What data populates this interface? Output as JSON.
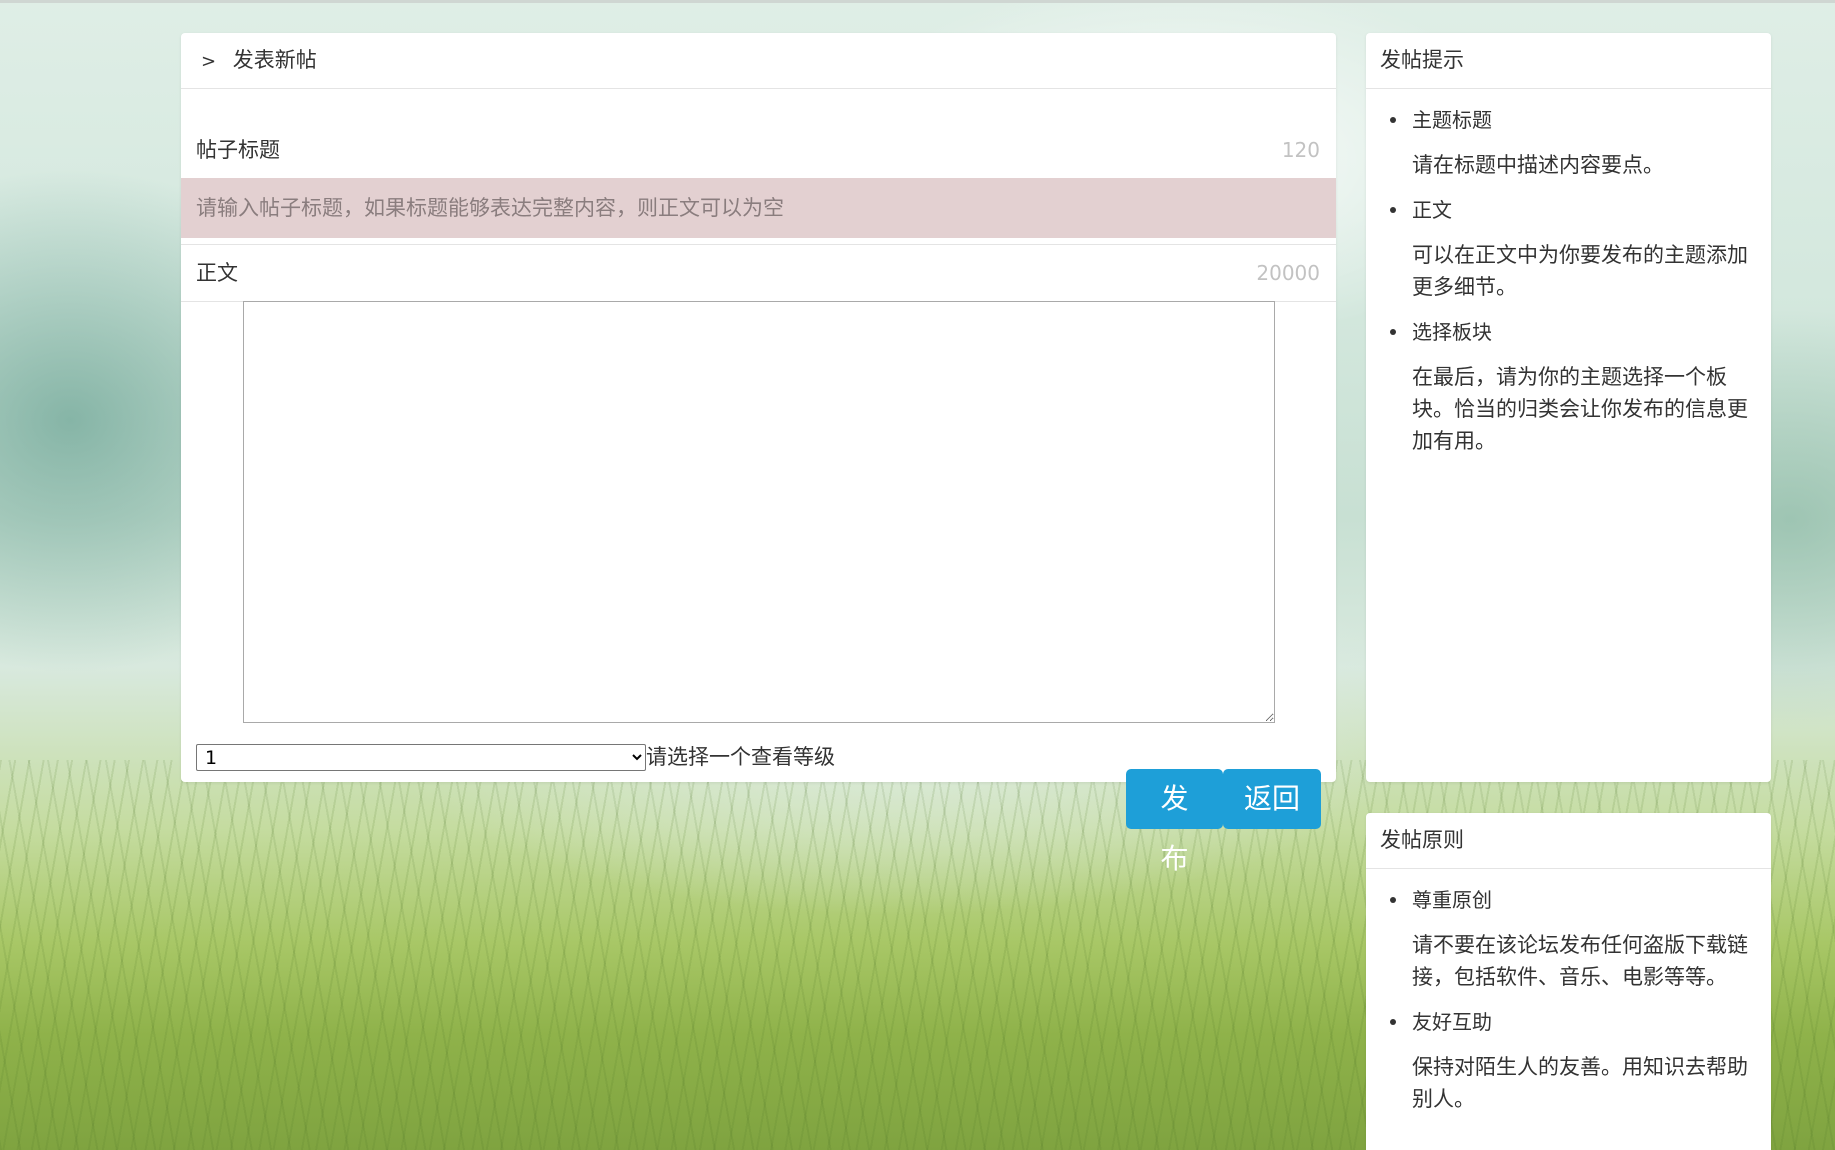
{
  "post_form": {
    "header_arrow": ">",
    "header_title": "发表新帖",
    "title_label": "帖子标题",
    "title_limit": "120",
    "title_placeholder": "请输入帖子标题，如果标题能够表达完整内容，则正文可以为空",
    "body_label": "正文",
    "body_limit": "20000",
    "body_value": "",
    "level_selected": "1",
    "level_hint": "请选择一个查看等级",
    "publish_label": "发布",
    "back_label": "返回"
  },
  "tips": {
    "title": "发帖提示",
    "items": [
      {
        "title": "主题标题",
        "text": "请在标题中描述内容要点。"
      },
      {
        "title": "正文",
        "text": "可以在正文中为你要发布的主题添加更多细节。"
      },
      {
        "title": "选择板块",
        "text": "在最后，请为你的主题选择一个板块。恰当的归类会让你发布的信息更加有用。"
      }
    ]
  },
  "rules": {
    "title": "发帖原则",
    "items": [
      {
        "title": "尊重原创",
        "text": "请不要在该论坛发布任何盗版下载链接，包括软件、音乐、电影等等。"
      },
      {
        "title": "友好互助",
        "text": "保持对陌生人的友善。用知识去帮助别人。"
      }
    ]
  },
  "colors": {
    "button_bg": "#1e9fd8",
    "title_input_bg": "#e3d0d1"
  }
}
